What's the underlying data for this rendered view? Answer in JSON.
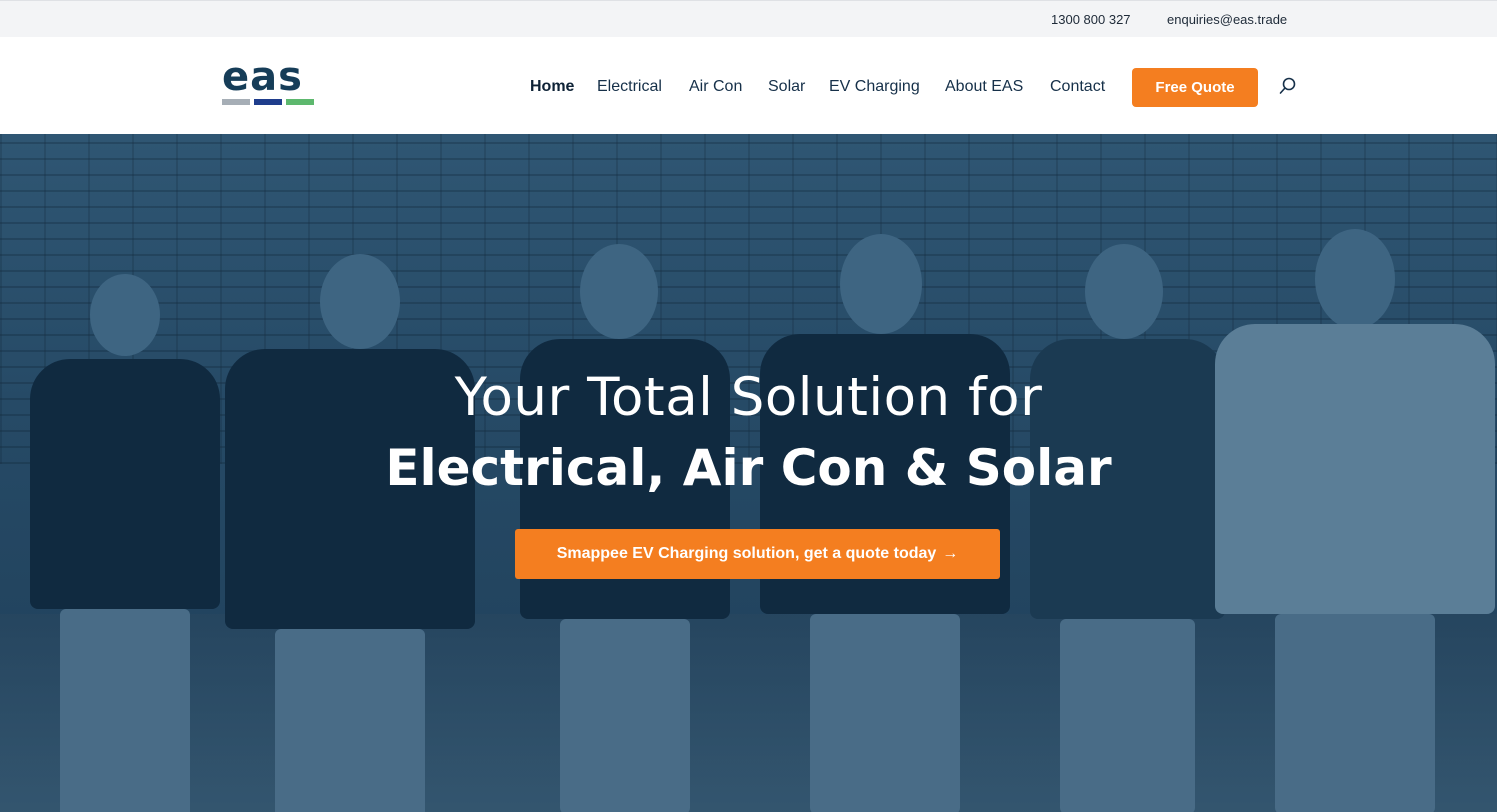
{
  "topbar": {
    "phone": "1300 800 327",
    "email": "enquiries@eas.trade"
  },
  "logo": {
    "text": "eas",
    "bar_colors": [
      "#a6aeb6",
      "#1f3d8c",
      "#5db86e"
    ]
  },
  "nav": {
    "items": [
      {
        "label": "Home",
        "active": true
      },
      {
        "label": "Electrical",
        "active": false
      },
      {
        "label": "Air Con",
        "active": false
      },
      {
        "label": "Solar",
        "active": false
      },
      {
        "label": "EV Charging",
        "active": false
      },
      {
        "label": "About EAS",
        "active": false
      },
      {
        "label": "Contact",
        "active": false
      }
    ],
    "cta_label": "Free Quote",
    "search_icon": "search-icon"
  },
  "hero": {
    "line1": "Your Total Solution for",
    "line2": "Electrical, Air Con & Solar",
    "button_label": "Smappee EV Charging solution, get a quote today",
    "button_arrow": "→"
  },
  "colors": {
    "accent": "#f47e20",
    "brand_dark": "#163d58",
    "hero_tint": "#264a66"
  }
}
